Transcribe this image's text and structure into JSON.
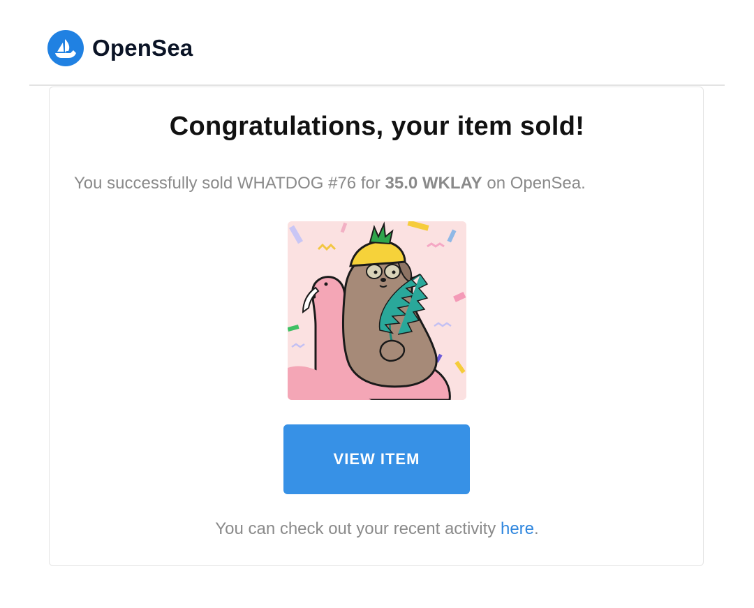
{
  "colors": {
    "brand_blue": "#2081e2",
    "button_blue": "#3791e6",
    "link_blue": "#2f86de",
    "text_gray": "#8a8a8a",
    "title_black": "#111111"
  },
  "header": {
    "logo_icon": "opensea-sailboat-icon",
    "brand_name": "OpenSea"
  },
  "card": {
    "title": "Congratulations, your item sold!",
    "summary": {
      "prefix": "You successfully sold WHATDOG #76 for ",
      "price": "35.0 WKLAY",
      "suffix": " on OpenSea."
    },
    "image": "whatdog-76-nft-image",
    "button_label": "VIEW ITEM",
    "footer": {
      "prefix": "You can check out your recent activity ",
      "link_text": "here",
      "suffix": "."
    }
  }
}
